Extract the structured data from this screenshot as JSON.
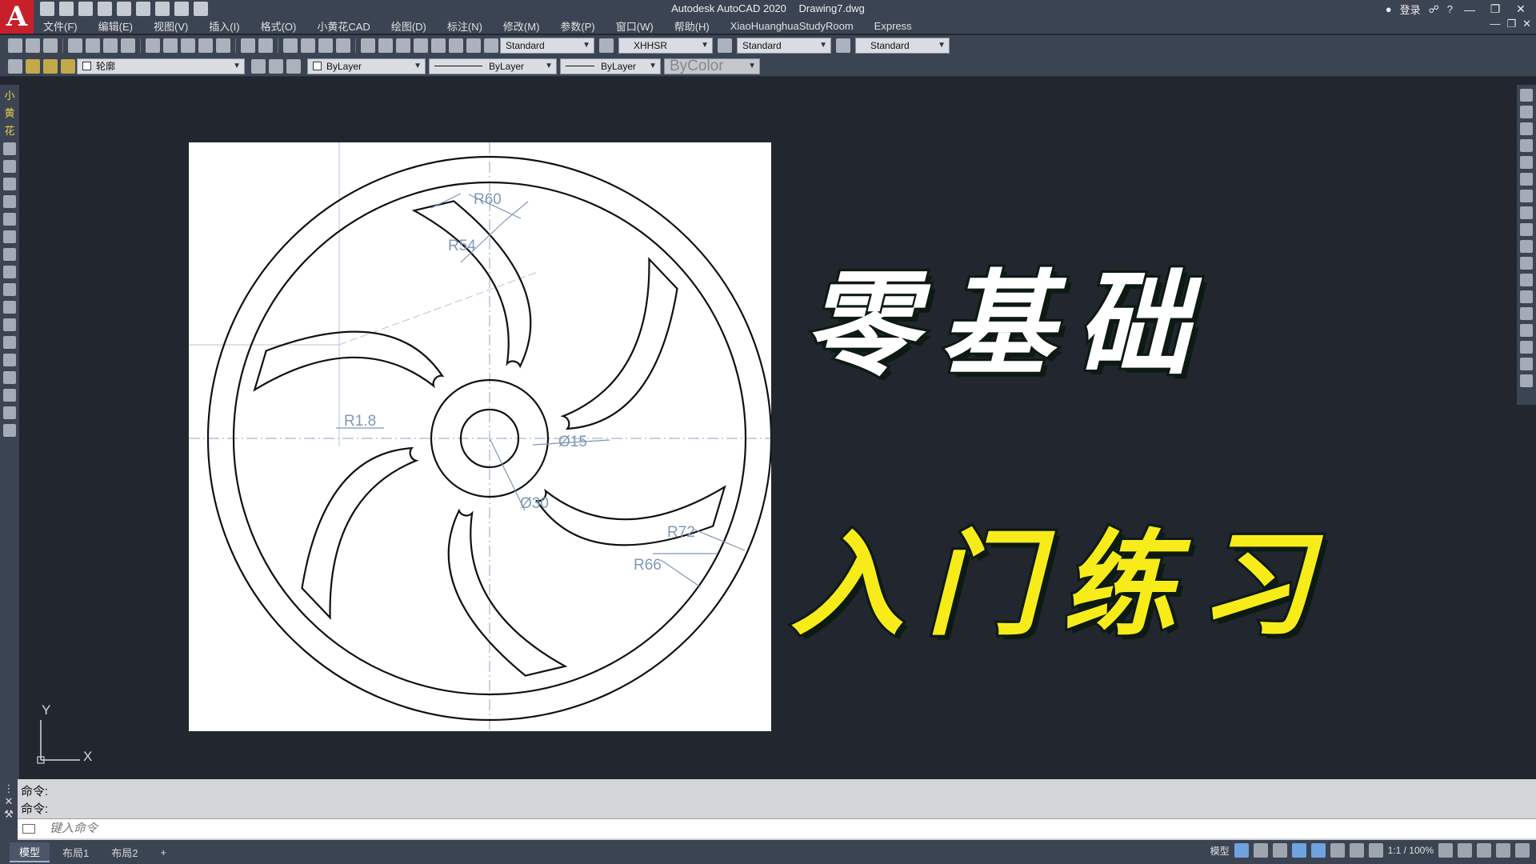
{
  "app": {
    "title": "Autodesk AutoCAD 2020",
    "file": "Drawing7.dwg",
    "logo": "A",
    "user": "登录",
    "help": "?"
  },
  "menu": {
    "items": [
      "文件(F)",
      "编辑(E)",
      "视图(V)",
      "插入(I)",
      "格式(O)",
      "小黄花CAD",
      "绘图(D)",
      "标注(N)",
      "修改(M)",
      "参数(P)",
      "窗口(W)",
      "帮助(H)",
      "XiaoHuanghuaStudyRoom",
      "Express"
    ]
  },
  "toolbar1": {
    "text_style": "Standard",
    "dim_style": "XHHSR",
    "table_style": "Standard",
    "mleader_style": "Standard"
  },
  "toolbar2": {
    "layer": "轮廓",
    "color": "ByLayer",
    "linetype": "ByLayer",
    "lineweight": "ByLayer",
    "plotstyle": "ByColor"
  },
  "leftbar": {
    "chars": [
      "小",
      "黄",
      "花"
    ]
  },
  "drawing": {
    "dimensions": {
      "r60": "R60",
      "r54": "R54",
      "r18": "R1.8",
      "d15": "Ø15",
      "d30": "Ø30",
      "r72": "R72",
      "r66": "R66"
    }
  },
  "captions": {
    "line1": "零基础",
    "line2": "入门练习"
  },
  "ucs": {
    "y": "Y",
    "x": "X"
  },
  "command": {
    "history": [
      "命令:",
      "命令:"
    ],
    "placeholder": "键入命令"
  },
  "status": {
    "tabs": [
      "模型",
      "布局1",
      "布局2",
      "+"
    ],
    "model_label": "模型",
    "scale": "1:1 / 100%"
  },
  "colors": {
    "ui_dark": "#3b4453",
    "canvas": "#21262f",
    "caption_white": "#ffffff",
    "caption_yellow": "#f7ec1a",
    "dimension": "#7f98b6"
  }
}
